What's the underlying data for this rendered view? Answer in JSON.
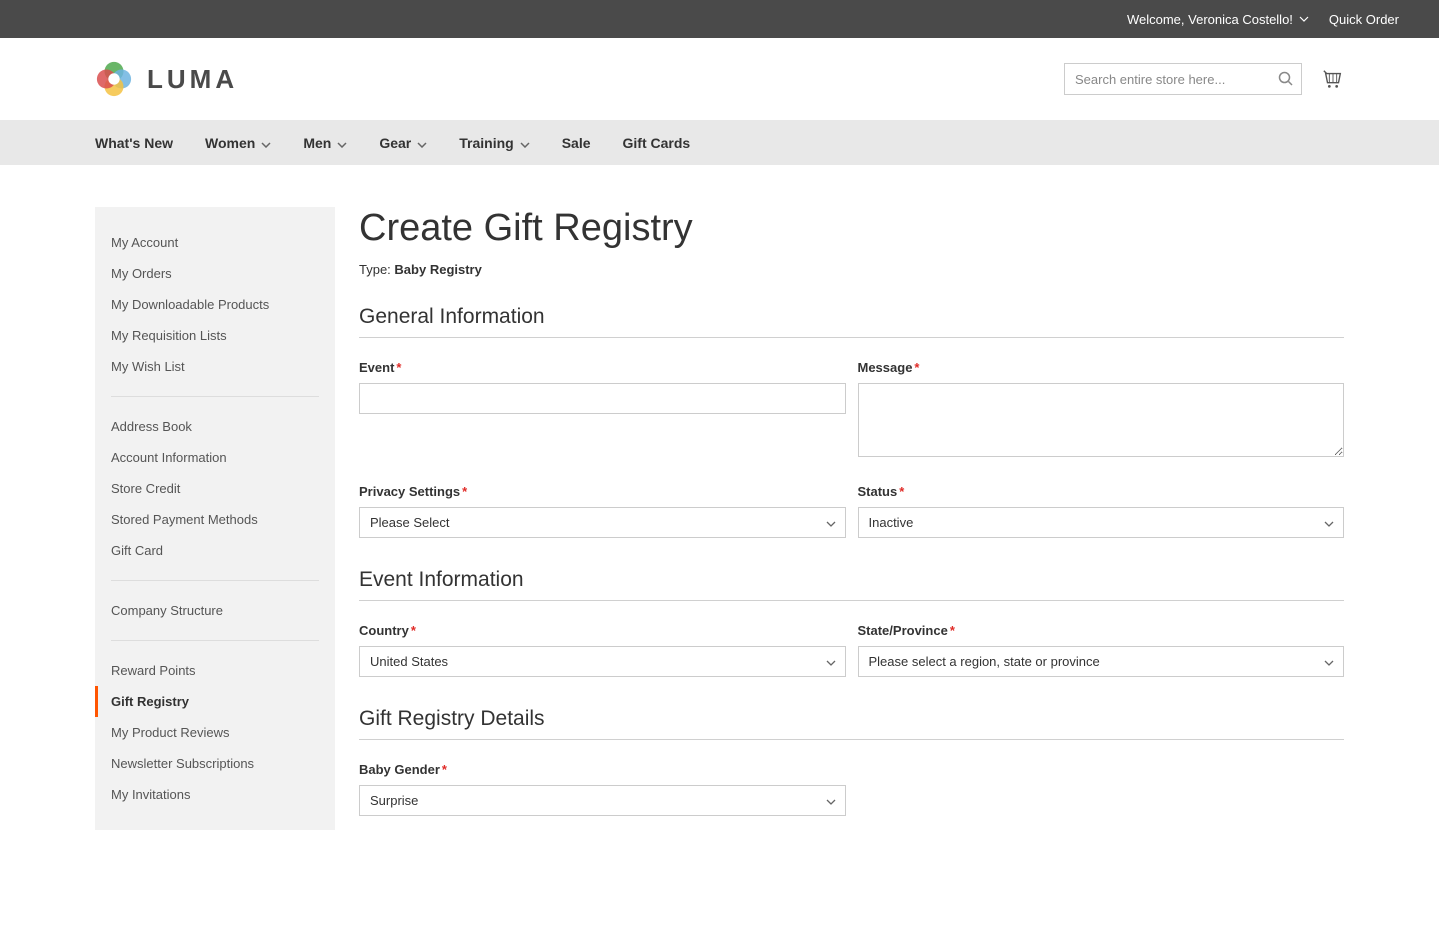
{
  "topbar": {
    "welcome": "Welcome, Veronica Costello!",
    "quick_order": "Quick Order"
  },
  "logo": {
    "text": "LUMA"
  },
  "search": {
    "placeholder": "Search entire store here..."
  },
  "nav": {
    "whats_new": "What's New",
    "women": "Women",
    "men": "Men",
    "gear": "Gear",
    "training": "Training",
    "sale": "Sale",
    "gift_cards": "Gift Cards"
  },
  "sidebar": {
    "my_account": "My Account",
    "my_orders": "My Orders",
    "my_downloadable": "My Downloadable Products",
    "my_requisition": "My Requisition Lists",
    "my_wishlist": "My Wish List",
    "address_book": "Address Book",
    "account_info": "Account Information",
    "store_credit": "Store Credit",
    "stored_payment": "Stored Payment Methods",
    "gift_card": "Gift Card",
    "company_structure": "Company Structure",
    "reward_points": "Reward Points",
    "gift_registry": "Gift Registry",
    "product_reviews": "My Product Reviews",
    "newsletter": "Newsletter Subscriptions",
    "invitations": "My Invitations"
  },
  "page": {
    "title": "Create Gift Registry",
    "type_label": "Type:",
    "type_value": "Baby Registry"
  },
  "sections": {
    "general": "General Information",
    "event": "Event Information",
    "details": "Gift Registry Details"
  },
  "fields": {
    "event": {
      "label": "Event",
      "value": ""
    },
    "message": {
      "label": "Message",
      "value": ""
    },
    "privacy": {
      "label": "Privacy Settings",
      "value": "Please Select"
    },
    "status": {
      "label": "Status",
      "value": "Inactive"
    },
    "country": {
      "label": "Country",
      "value": "United States"
    },
    "state": {
      "label": "State/Province",
      "value": "Please select a region, state or province"
    },
    "baby_gender": {
      "label": "Baby Gender",
      "value": "Surprise"
    }
  }
}
